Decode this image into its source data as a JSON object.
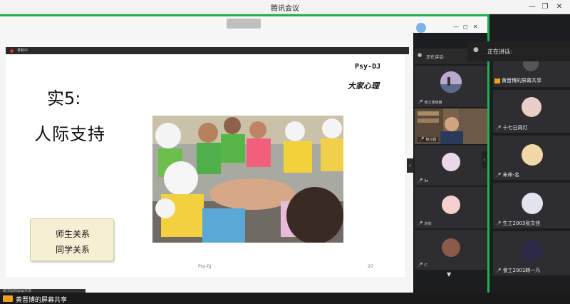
{
  "window": {
    "title": "腾讯会议"
  },
  "share_tab": {
    "label": ""
  },
  "recording": {
    "label": "录制中"
  },
  "slide": {
    "brand_en": "Psy-DJ",
    "brand_cn": "大家心理",
    "title_line1": "实5:",
    "title_line2": "人际支持",
    "relations": [
      "师生关系",
      "同学关系"
    ],
    "footer_left": "Psy-DJ",
    "footer_right": "20"
  },
  "speaker_chip": {
    "label": ""
  },
  "column1": {
    "header": "正在讲话:",
    "tiles": [
      {
        "name": "食工张晓丽"
      },
      {
        "name": "柳汉超"
      },
      {
        "name": "lin"
      },
      {
        "name": "刘欣"
      },
      {
        "name": "仁"
      }
    ]
  },
  "column2": {
    "header": "正在讲话:",
    "tiles": [
      {
        "name": "黄晋博的屏幕共享"
      },
      {
        "name": "十七日周灯"
      },
      {
        "name": "未命-名"
      },
      {
        "name": "生工2003张文佳"
      },
      {
        "name": "食工2001韩一凡"
      }
    ]
  },
  "bottom": {
    "strip_text": "柳汉超的屏幕共享",
    "share_label": "黄晋博的屏幕共享"
  },
  "colors": {
    "accent_green": "#20b050",
    "titlebar": "#f3f3f3",
    "slide_bg": "#ffffff"
  }
}
